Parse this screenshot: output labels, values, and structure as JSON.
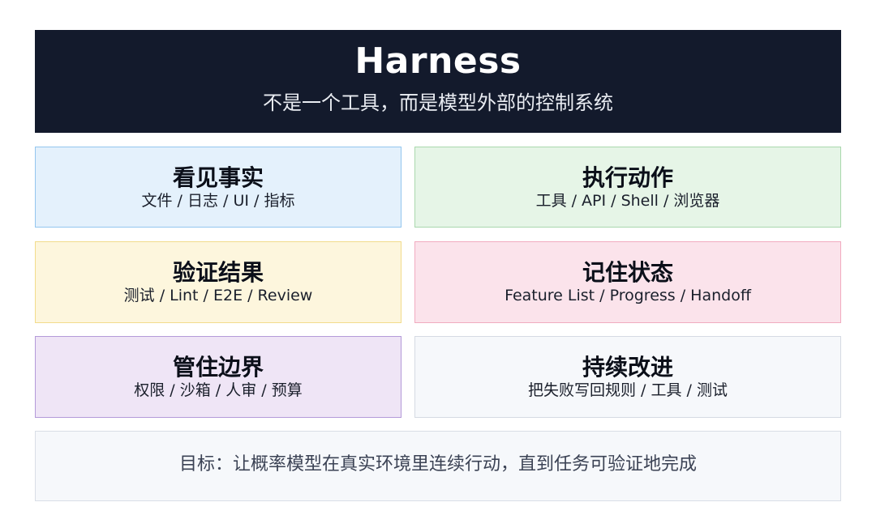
{
  "header": {
    "title": "Harness",
    "subtitle": "不是一个工具，而是模型外部的控制系统"
  },
  "cards": [
    {
      "title": "看见事实",
      "subtitle": "文件 / 日志 / UI / 指标",
      "bg": "#e4f1fc",
      "border": "#93c6ef"
    },
    {
      "title": "执行动作",
      "subtitle": "工具 / API / Shell / 浏览器",
      "bg": "#e6f5e7",
      "border": "#a9d8ad"
    },
    {
      "title": "验证结果",
      "subtitle": "测试 / Lint / E2E / Review",
      "bg": "#fdf6dd",
      "border": "#f2dc8c"
    },
    {
      "title": "记住状态",
      "subtitle": "Feature List / Progress / Handoff",
      "bg": "#fbe3eb",
      "border": "#f1abc0"
    },
    {
      "title": "管住边界",
      "subtitle": "权限 / 沙箱 / 人审 / 预算",
      "bg": "#efe5f6",
      "border": "#b49ad9"
    },
    {
      "title": "持续改进",
      "subtitle": "把失败写回规则 / 工具 / 测试",
      "bg": "#f6f8fb",
      "border": "#d5dae3"
    }
  ],
  "goal": {
    "text": "目标：让概率模型在真实环境里连续行动，直到任务可验证地完成"
  }
}
